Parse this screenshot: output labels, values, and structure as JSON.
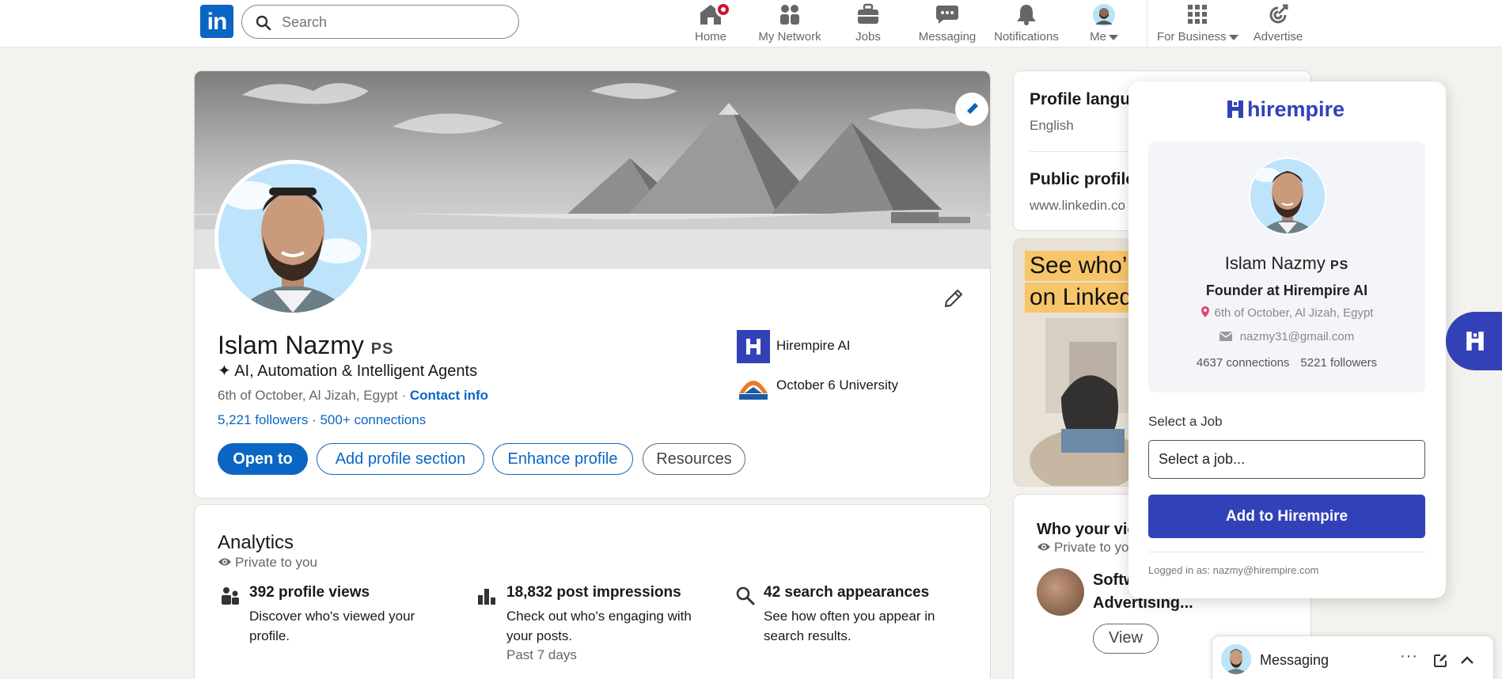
{
  "nav": {
    "search_placeholder": "Search",
    "items": [
      {
        "label": "Home",
        "icon": "home-icon"
      },
      {
        "label": "My Network",
        "icon": "network-icon"
      },
      {
        "label": "Jobs",
        "icon": "briefcase-icon"
      },
      {
        "label": "Messaging",
        "icon": "messaging-icon"
      },
      {
        "label": "Notifications",
        "icon": "bell-icon"
      },
      {
        "label": "Me",
        "icon": "avatar"
      },
      {
        "label": "For Business",
        "icon": "grid-icon"
      },
      {
        "label": "Advertise",
        "icon": "advertise-icon"
      }
    ]
  },
  "profile": {
    "name": "Islam Nazmy",
    "pronoun_badge": "PS",
    "headline": "✦ AI, Automation & Intelligent Agents",
    "location": "6th of October, Al Jizah, Egypt",
    "location_sep": " · ",
    "contact_info": "Contact info",
    "followers": "5,221 followers",
    "connections": " · 500+ connections",
    "buttons": {
      "open_to": "Open to",
      "add_section": "Add profile section",
      "enhance": "Enhance profile",
      "resources": "Resources"
    },
    "orgs": [
      {
        "name": "Hirempire AI"
      },
      {
        "name": "October 6 University"
      }
    ]
  },
  "analytics": {
    "title": "Analytics",
    "private": "Private to you",
    "items": [
      {
        "title": "392 profile views",
        "desc": "Discover who's viewed your profile.",
        "sub": ""
      },
      {
        "title": "18,832 post impressions",
        "desc": "Check out who's engaging with your posts.",
        "sub": "Past 7 days"
      },
      {
        "title": "42 search appearances",
        "desc": "See how often you appear in search results.",
        "sub": ""
      }
    ]
  },
  "sidebar": {
    "profile_language_label": "Profile langu",
    "profile_language_value": "English",
    "public_profile_label": "Public profile",
    "public_profile_value": "www.linkedin.co",
    "ad_line1": "See who’",
    "ad_line2": "on Linked",
    "viewers_title": "Who your vie",
    "viewers_private": "Private to yo",
    "viewer_name_line1": "Softw",
    "viewer_name_line2": "Advertising...",
    "view_button": "View"
  },
  "hirempire": {
    "brand": "hirempire",
    "name": "Islam Nazmy",
    "pronoun_badge": "PS",
    "role": "Founder at Hirempire AI",
    "location": "6th of October, Al Jizah, Egypt",
    "email": "nazmy31@gmail.com",
    "connections": "4637 connections",
    "followers": "5221 followers",
    "select_label": "Select a Job",
    "select_value": "Select a job...",
    "add_button": "Add to Hirempire",
    "logged_in": "Logged in as: nazmy@hirempire.com",
    "accent": "#3341b8"
  },
  "messaging": {
    "title": "Messaging",
    "more": "···"
  },
  "colors": {
    "linkedin_blue": "#0a66c2",
    "background": "#f4f2ee",
    "notification_red": "#cb112d"
  }
}
